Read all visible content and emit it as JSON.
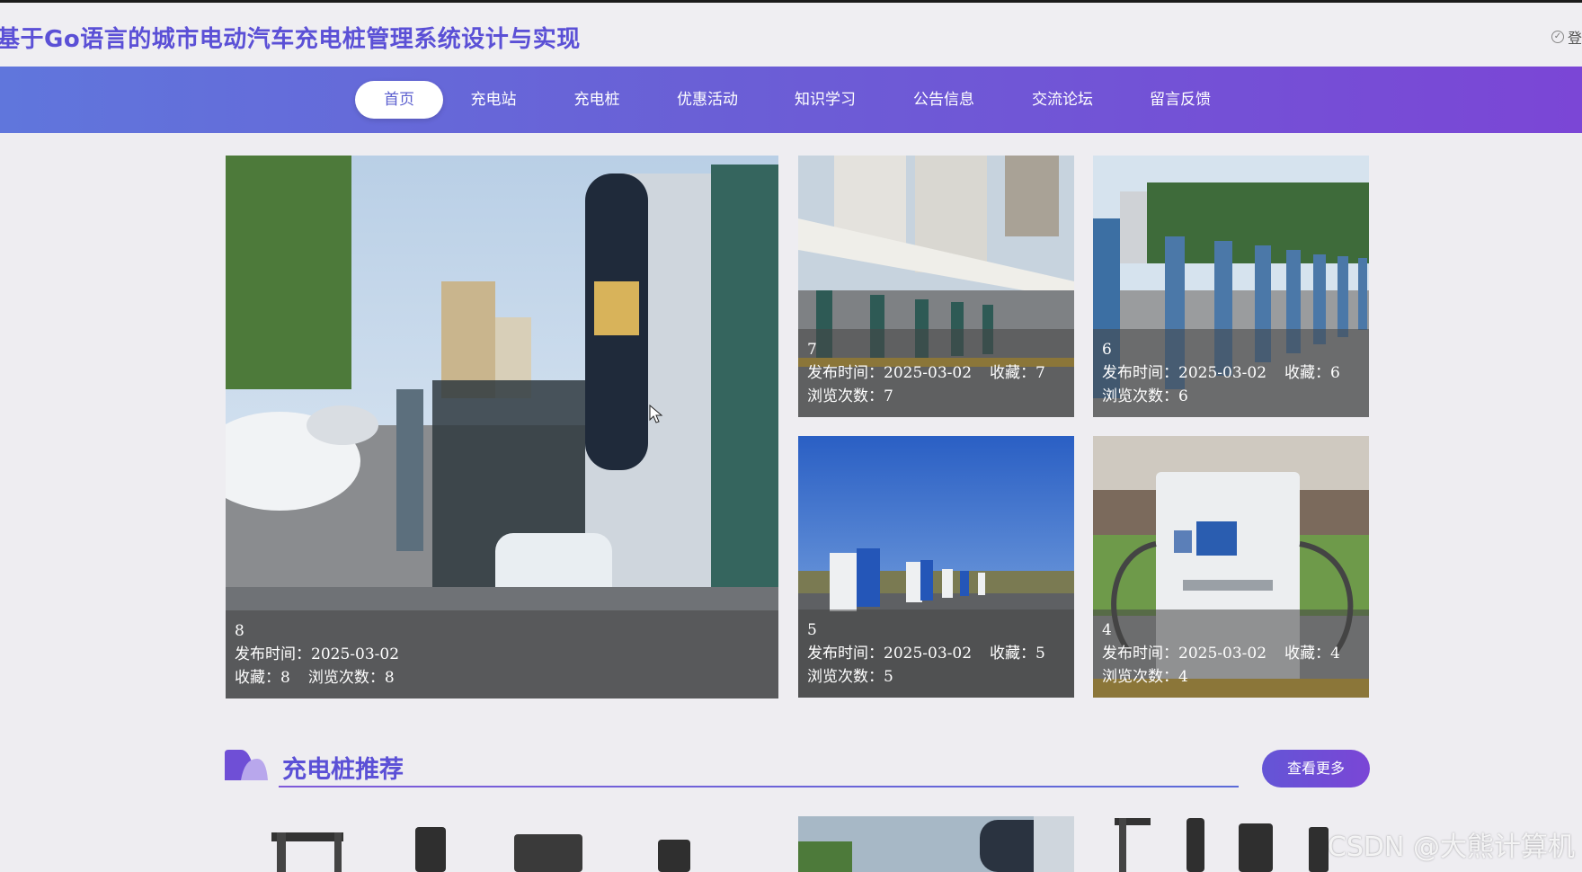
{
  "header": {
    "site_title": "基于Go语言的城市电动汽车充电桩管理系统设计与实现",
    "login_label": "登"
  },
  "nav": {
    "items": [
      {
        "label": "首页",
        "active": true
      },
      {
        "label": "充电站",
        "active": false
      },
      {
        "label": "充电桩",
        "active": false
      },
      {
        "label": "优惠活动",
        "active": false
      },
      {
        "label": "知识学习",
        "active": false
      },
      {
        "label": "公告信息",
        "active": false
      },
      {
        "label": "交流论坛",
        "active": false
      },
      {
        "label": "留言反馈",
        "active": false
      }
    ]
  },
  "labels": {
    "publish_time": "发布时间：",
    "favorites": "收藏：",
    "views": "浏览次数："
  },
  "featured": [
    {
      "title": "8",
      "date": "2025-03-02",
      "favorites": "8",
      "views": "8",
      "image": "charging-pile-street-photo"
    },
    {
      "title": "7",
      "date": "2025-03-02",
      "favorites": "7",
      "views": "7",
      "image": "charging-station-canopy-photo"
    },
    {
      "title": "6",
      "date": "2025-03-02",
      "favorites": "6",
      "views": "6",
      "image": "charging-pile-row-photo"
    },
    {
      "title": "5",
      "date": "2025-03-02",
      "favorites": "5",
      "views": "5",
      "image": "charging-pile-open-lot-photo"
    },
    {
      "title": "4",
      "date": "2025-03-02",
      "favorites": "4",
      "views": "4",
      "image": "dc-charger-photo"
    }
  ],
  "section": {
    "title": "充电桩推荐",
    "more_label": "查看更多"
  },
  "watermark": "CSDN @大熊计算机",
  "colors": {
    "accent": "#5b50d6",
    "nav_start": "#6076dc",
    "nav_end": "#7b46d6",
    "background": "#eeedf1"
  }
}
